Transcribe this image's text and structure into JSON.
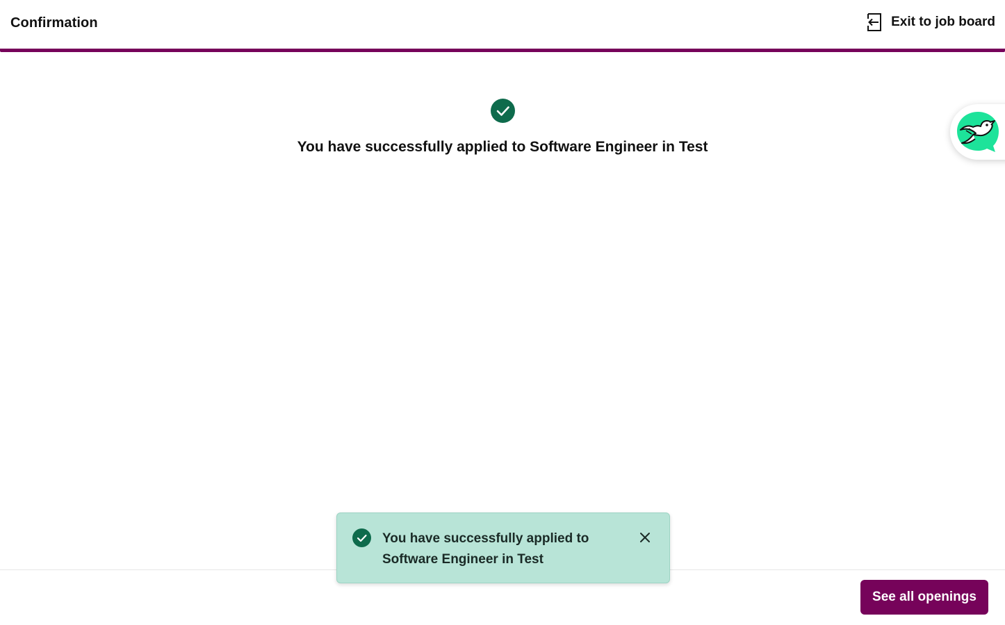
{
  "header": {
    "title": "Confirmation",
    "exit_label": "Exit to job board",
    "exit_icon": "exit-door-icon",
    "accent_color": "#76035a"
  },
  "main": {
    "success_message": "You have successfully applied to Software Engineer in Test",
    "success_icon": "check-circle-icon",
    "success_color": "#0e6b4c"
  },
  "chat": {
    "icon": "bird-chat-icon",
    "bubble_color": "#1de39a"
  },
  "footer": {
    "see_all_label": "See all openings"
  },
  "toast": {
    "message": "You have successfully applied to Software Engineer in Test",
    "icon": "check-circle-icon",
    "close_icon": "close-icon",
    "background": "#b8e4d7"
  }
}
